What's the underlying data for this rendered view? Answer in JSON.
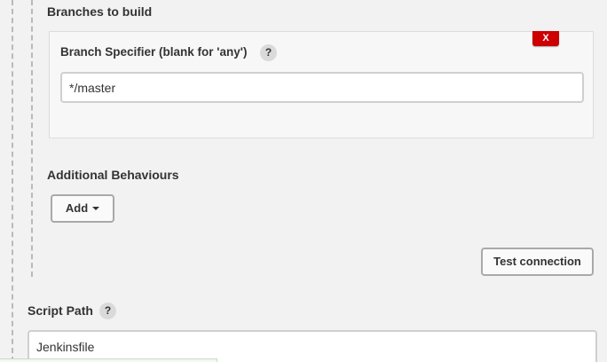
{
  "branches": {
    "title": "Branches to build",
    "remove_label": "X",
    "specifier_label": "Branch Specifier (blank for 'any')",
    "help_label": "?",
    "specifier_value": "*/master"
  },
  "behaviours": {
    "title": "Additional Behaviours",
    "add_label": "Add"
  },
  "test_connection_label": "Test connection",
  "script_path": {
    "label": "Script Path",
    "help_label": "?",
    "value": "Jenkinsfile"
  },
  "colors": {
    "remove_button": "#cc0000",
    "background": "#f2f2f2",
    "panel": "#f7f7f7"
  },
  "icons": {
    "help": "question-mark-circle",
    "add_dropdown": "caret-down"
  }
}
